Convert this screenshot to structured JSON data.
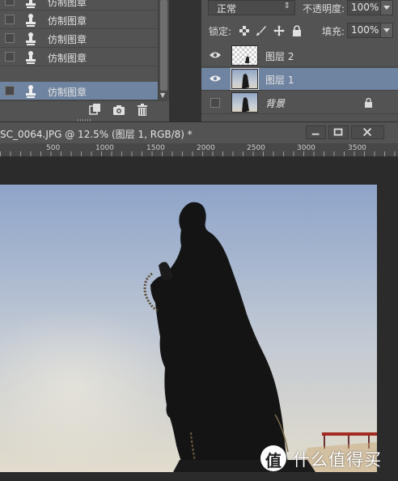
{
  "history_panel": {
    "items": [
      {
        "label": "仿制图章",
        "selected": false
      },
      {
        "label": "仿制图章",
        "selected": false
      },
      {
        "label": "仿制图章",
        "selected": false
      },
      {
        "label": "仿制图章",
        "selected": false
      },
      {
        "label": "仿制图章",
        "selected": true
      }
    ],
    "footer_icons": [
      "new-document-icon",
      "camera-icon",
      "trash-icon"
    ]
  },
  "layers_panel": {
    "blend_mode": "正常",
    "opacity_label": "不透明度:",
    "opacity_value": "100%",
    "lock_label": "锁定:",
    "lock_icons": [
      "lock-transparent-icon",
      "lock-brush-icon",
      "lock-move-icon",
      "lock-all-icon"
    ],
    "fill_label": "填充:",
    "fill_value": "100%",
    "layers": [
      {
        "name": "图层 2",
        "visible": true,
        "selected": false,
        "thumbnail": "transparent"
      },
      {
        "name": "图层 1",
        "visible": true,
        "selected": true,
        "thumbnail": "photo"
      },
      {
        "name": "背景",
        "visible": false,
        "selected": false,
        "thumbnail": "photo",
        "locked": true
      }
    ]
  },
  "document": {
    "title": "SC_0064.JPG @ 12.5% (图层 1, RGB/8) *",
    "ruler_ticks": [
      "500",
      "1000",
      "1500",
      "2000",
      "2500",
      "3000",
      "3500"
    ],
    "window_buttons": [
      "minimize-icon",
      "maximize-icon",
      "close-icon"
    ]
  },
  "watermark": {
    "badge": "值",
    "text": "什么值得买"
  },
  "colors": {
    "panel_bg": "#535353",
    "selection": "#6f84a0",
    "dark_bg": "#2b2b2b"
  }
}
